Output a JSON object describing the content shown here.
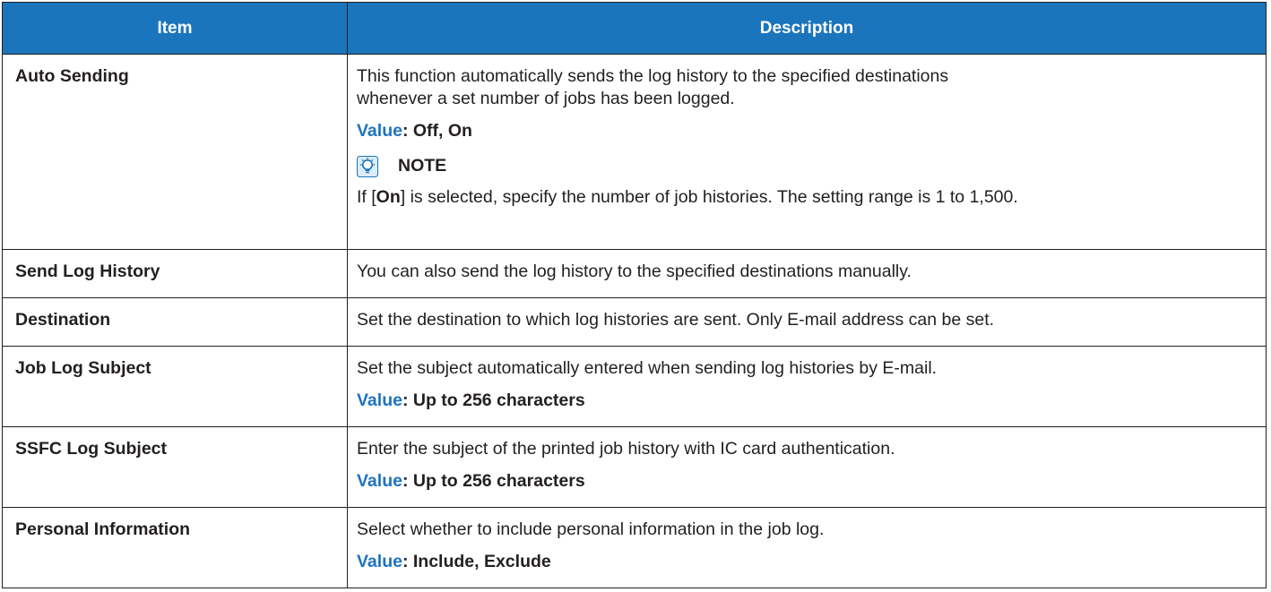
{
  "table": {
    "headers": {
      "item": "Item",
      "description": "Description"
    },
    "rows": {
      "auto_sending": {
        "item": "Auto Sending",
        "desc_1": "This function automatically sends the log history to the specified destinations",
        "desc_2": "whenever a set number of jobs has been logged.",
        "value_label": "Value",
        "value_text": ": Off, On",
        "note_title": "NOTE",
        "note_pre": "If [",
        "note_selected": "On",
        "note_post": "] is selected, specify the number of job histories. The setting range is 1 to 1,500."
      },
      "send_log_history": {
        "item": "Send Log History",
        "desc": "You can also send the log history to the specified destinations manually."
      },
      "destination": {
        "item": "Destination",
        "desc": "Set the destination to which log histories are sent. Only E-mail address can be set."
      },
      "job_log_subject": {
        "item": "Job Log Subject",
        "desc": "Set the subject automatically entered when sending log histories by E-mail.",
        "value_label": "Value",
        "value_text": ": Up to 256 characters"
      },
      "ssfc_log_subject": {
        "item": "SSFC Log Subject",
        "desc": "Enter the subject of the printed job history with IC card authentication.",
        "value_label": "Value",
        "value_text": ": Up to 256 characters"
      },
      "personal_information": {
        "item": "Personal Information",
        "desc": "Select whether to include personal information in the job log.",
        "value_label": "Value",
        "value_text": ": Include, Exclude"
      }
    }
  },
  "colors": {
    "header_bg": "#1b75bc",
    "header_text": "#ffffff",
    "value_label": "#1e73be",
    "border": "#231f20"
  },
  "icons": {
    "note": "note-lightbulb-icon"
  }
}
